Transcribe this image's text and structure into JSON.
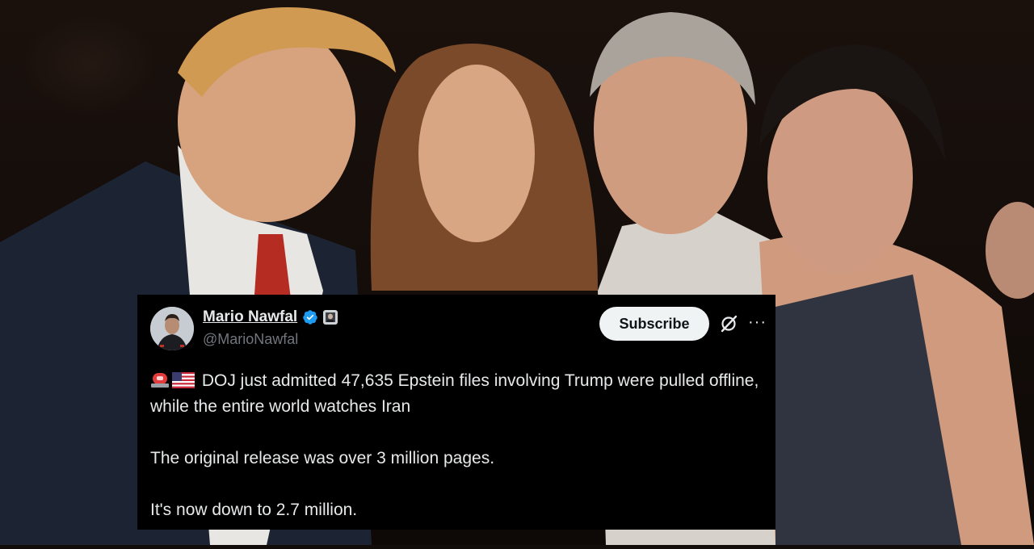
{
  "tweet": {
    "display_name": "Mario Nawfal",
    "handle": "@MarioNawfal",
    "subscribe_label": "Subscribe",
    "more_label": "···",
    "lines": {
      "p1": "DOJ just admitted 47,635 Epstein files involving Trump were pulled offline, while the entire world watches Iran",
      "p2": "The original release was over 3 million pages.",
      "p3": "It's now down to 2.7 million."
    },
    "emojis": [
      "police-siren-icon",
      "us-flag-icon"
    ]
  },
  "icons": {
    "verified": "verified-badge-icon",
    "affiliate": "affiliate-badge-icon",
    "grok": "grok-icon",
    "more": "more-options-icon"
  },
  "colors": {
    "card_background": "#000000",
    "primary_text": "#e7e9ea",
    "secondary_text": "#71767b",
    "verified_blue": "#1d9bf0",
    "subscribe_bg": "#eff3f4"
  }
}
